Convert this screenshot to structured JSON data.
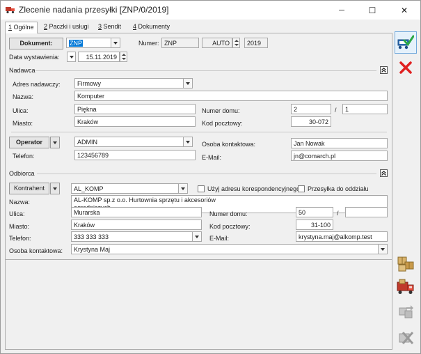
{
  "window": {
    "title": "Zlecenie nadania przesyłki [ZNP/0/2019]",
    "minimize_glyph": "─",
    "maximize_glyph": "☐",
    "close_glyph": "✕"
  },
  "tabs": [
    {
      "key": "1",
      "label": " Ogólne",
      "active": true
    },
    {
      "key": "2",
      "label": " Paczki i usługi",
      "active": false
    },
    {
      "key": "3",
      "label": " Sendit",
      "active": false
    },
    {
      "key": "4",
      "label": " Dokumenty",
      "active": false
    }
  ],
  "document": {
    "button_label": "Dokument:",
    "type_value": "ZNP",
    "numer_label": "Numer:",
    "numer_prefix": "ZNP",
    "numer_mode": "AUTO",
    "year": "2019",
    "date_label": "Data wystawienia:",
    "date_value": "15.11.2019"
  },
  "nadawca": {
    "section_title": "Nadawca",
    "adres_label": "Adres nadawczy:",
    "adres_value": "Firmowy",
    "nazwa_label": "Nazwa:",
    "nazwa_value": "Komputer",
    "ulica_label": "Ulica:",
    "ulica_value": "Piękna",
    "numer_domu_label": "Numer domu:",
    "numer_domu_value": "2",
    "numer_lokalu_sep": "/",
    "numer_lokalu_value": "1",
    "miasto_label": "Miasto:",
    "miasto_value": "Kraków",
    "kod_label": "Kod pocztowy:",
    "kod_value": "30-072",
    "operator_button": "Operator",
    "operator_value": "ADMIN",
    "osoba_label": "Osoba kontaktowa:",
    "osoba_value": "Jan Nowak",
    "telefon_label": "Telefon:",
    "telefon_value": "123456789",
    "email_label": "E-Mail:",
    "email_value": "jn@comarch.pl"
  },
  "odbiorca": {
    "section_title": "Odbiorca",
    "kontrahent_button": "Kontrahent",
    "kontrahent_value": "AL_KOMP",
    "korespondencyjny_label": "Użyj adresu korespondencyjnego",
    "oddzial_label": "Przesyłka do oddziału",
    "nazwa_label": "Nazwa:",
    "nazwa_line1": "AL-KOMP sp.z o.o. Hurtownia sprzętu i akcesoriów",
    "nazwa_line2": "ogrodniczych",
    "ulica_label": "Ulica:",
    "ulica_value": "Murarska",
    "numer_domu_label": "Numer domu:",
    "numer_domu_value": "50",
    "numer_lokalu_sep": "/",
    "numer_lokalu_value": "",
    "miasto_label": "Miasto:",
    "miasto_value": "Kraków",
    "kod_label": "Kod pocztowy:",
    "kod_value": "31-100",
    "telefon_label": "Telefon:",
    "telefon_value": "333 333 333",
    "email_label": "E-Mail:",
    "email_value": "krystyna.maj@alkomp.test",
    "osoba_label": "Osoba kontaktowa:",
    "osoba_value": "Krystyna Maj"
  },
  "side_buttons": [
    {
      "name": "save-icon"
    },
    {
      "name": "cancel-icon"
    },
    {
      "name": "packages-icon"
    },
    {
      "name": "courier-truck-icon"
    },
    {
      "name": "disabled-action-icon"
    },
    {
      "name": "disabled-cancel-icon"
    }
  ],
  "colors": {
    "accent_blue": "#0078d7",
    "cancel_red": "#e02020",
    "truck_red": "#c0392b"
  }
}
